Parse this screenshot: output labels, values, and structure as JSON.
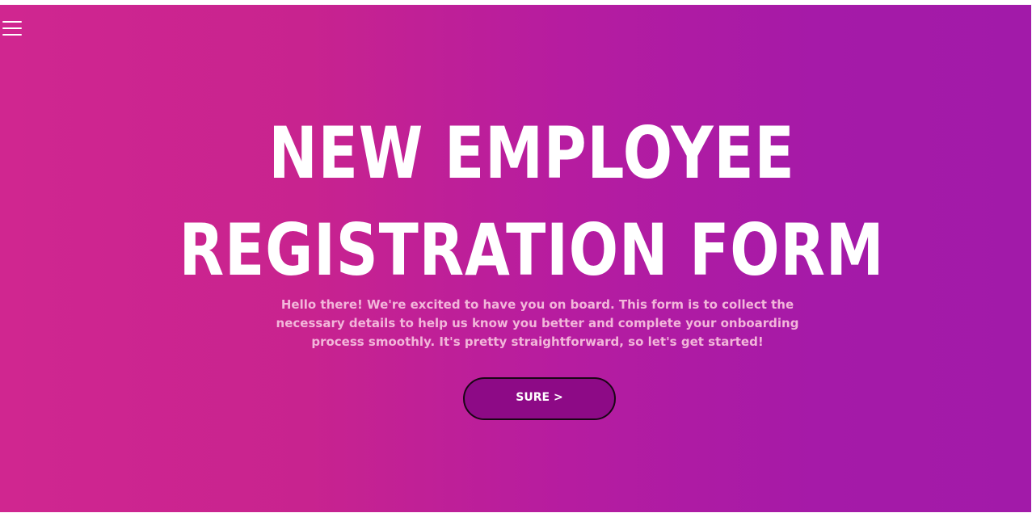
{
  "menu": {
    "icon": "hamburger-menu-icon"
  },
  "hero": {
    "title_line1": "NEW EMPLOYEE",
    "title_line2": "REGISTRATION FORM",
    "intro_text": "Hello there! We're excited to have you on board. This form is to collect the necessary details to help us know you better and complete your onboarding process smoothly. It's pretty straightforward, so let's get started!",
    "button_label": "SURE >"
  },
  "colors": {
    "gradient_start": "#d02690",
    "gradient_end": "#a21aa9",
    "button_bg": "#8d0a86",
    "intro_text": "#f2b6da"
  }
}
